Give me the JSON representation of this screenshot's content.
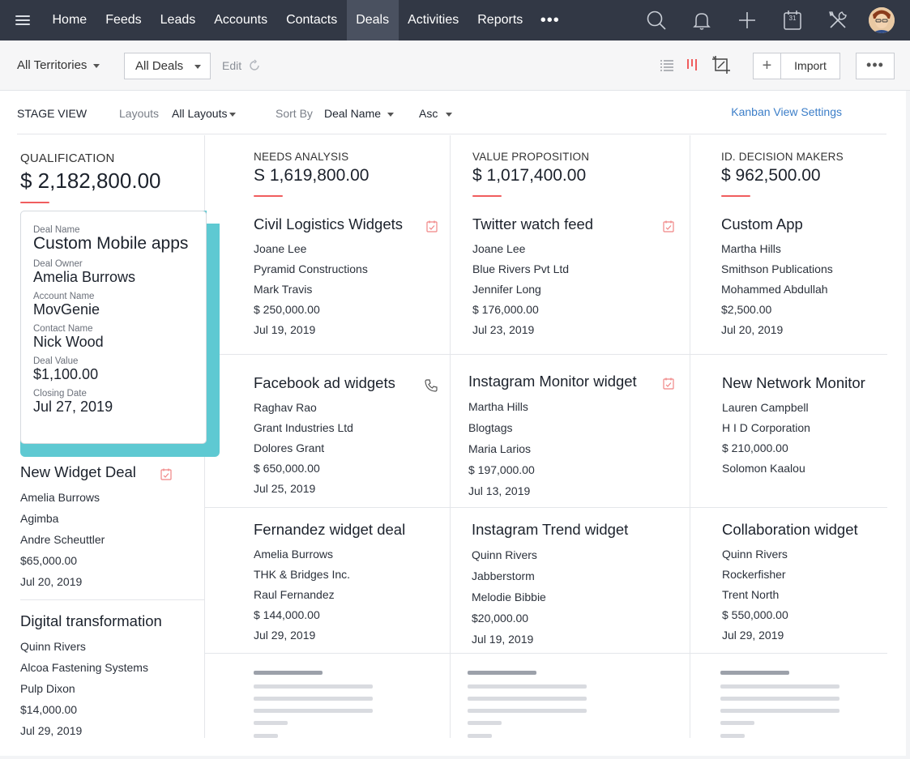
{
  "nav": {
    "items": [
      "Home",
      "Feeds",
      "Leads",
      "Accounts",
      "Contacts",
      "Deals",
      "Activities",
      "Reports"
    ],
    "active": "Deals",
    "more": "•••",
    "icons": [
      "search-icon",
      "bell-icon",
      "plus-icon",
      "calendar-icon",
      "tools-icon",
      "avatar"
    ],
    "calendar_day": "31"
  },
  "toolbar": {
    "territory": "All Territories",
    "deal_filter": "All Deals",
    "edit": "Edit",
    "import": "Import",
    "more": "•••"
  },
  "viewbar": {
    "stage_view": "STAGE VIEW",
    "layouts_label": "Layouts",
    "layouts_value": "All Layouts",
    "sortby_label": "Sort By",
    "sortby_value": "Deal Name",
    "order": "Asc",
    "kanban_settings": "Kanban View Settings"
  },
  "columns": [
    {
      "stage": "QUALIFICATION",
      "amount": "$ 2,182,800.00",
      "highlight": {
        "labels": [
          "Deal Name",
          "Deal Owner",
          "Account Name",
          "Contact Name",
          "Deal Value",
          "Closing Date"
        ],
        "values": [
          "Custom Mobile apps",
          "Amelia Burrows",
          "MovGenie",
          "Nick Wood",
          "$1,100.00",
          "Jul 27, 2019"
        ]
      },
      "cards": [
        {
          "title": "New Widget Deal",
          "lines": [
            "Amelia Burrows",
            "Agimba",
            "Andre Scheuttler",
            "$65,000.00",
            "Jul 20, 2019"
          ],
          "icon": "task-icon"
        },
        {
          "title": "Digital transformation",
          "lines": [
            "Quinn Rivers",
            "Alcoa Fastening Systems",
            "Pulp Dixon",
            "$14,000.00",
            "Jul 29, 2019"
          ],
          "icon": ""
        }
      ]
    },
    {
      "stage": "NEEDS ANALYSIS",
      "amount": "S 1,619,800.00",
      "cards": [
        {
          "title": "Civil Logistics Widgets",
          "lines": [
            "Joane Lee",
            "Pyramid Constructions",
            "Mark Travis",
            "$ 250,000.00",
            "Jul 19, 2019"
          ],
          "icon": "task-icon"
        },
        {
          "title": "Facebook ad widgets",
          "lines": [
            "Raghav Rao",
            "Grant Industries Ltd",
            "Dolores Grant",
            "$ 650,000.00",
            "Jul 25, 2019"
          ],
          "icon": "phone-icon"
        },
        {
          "title": "Fernandez widget deal",
          "lines": [
            "Amelia Burrows",
            "THK & Bridges Inc.",
            "Raul Fernandez",
            "$ 144,000.00",
            "Jul 29, 2019"
          ],
          "icon": ""
        }
      ]
    },
    {
      "stage": "VALUE PROPOSITION",
      "amount": "$ 1,017,400.00",
      "cards": [
        {
          "title": "Twitter watch feed",
          "lines": [
            "Joane Lee",
            "Blue Rivers Pvt Ltd",
            "Jennifer Long",
            "$ 176,000.00",
            "Jul 23, 2019"
          ],
          "icon": "task-icon"
        },
        {
          "title": "Instagram Monitor widget",
          "lines": [
            "Martha Hills",
            "Blogtags",
            "Maria Larios",
            "$ 197,000.00",
            "Jul 13, 2019"
          ],
          "icon": "task-icon"
        },
        {
          "title": "Instagram Trend widget",
          "lines": [
            "Quinn Rivers",
            "Jabberstorm",
            "Melodie Bibbie",
            "$20,000.00",
            "Jul 19, 2019"
          ],
          "icon": ""
        }
      ]
    },
    {
      "stage": "ID. DECISION MAKERS",
      "amount": "$ 962,500.00",
      "cards": [
        {
          "title": "Custom App",
          "lines": [
            "Martha Hills",
            "Smithson Publications",
            "Mohammed Abdullah",
            "$2,500.00",
            "Jul 20, 2019"
          ],
          "icon": ""
        },
        {
          "title": "New Network Monitor",
          "lines": [
            "Lauren Campbell",
            "H I D Corporation",
            "$ 210,000.00",
            "Solomon Kaalou"
          ],
          "icon": ""
        },
        {
          "title": "Collaboration widget",
          "lines": [
            "Quinn Rivers",
            "Rockerfisher",
            "Trent North",
            "$ 550,000.00",
            "Jul 29, 2019"
          ],
          "icon": ""
        }
      ]
    }
  ],
  "colors": {
    "nav_bg": "#323845",
    "accent_red": "#f05d5e",
    "highlight_teal": "#5ec9d2",
    "link_blue": "#3c7ec8"
  }
}
